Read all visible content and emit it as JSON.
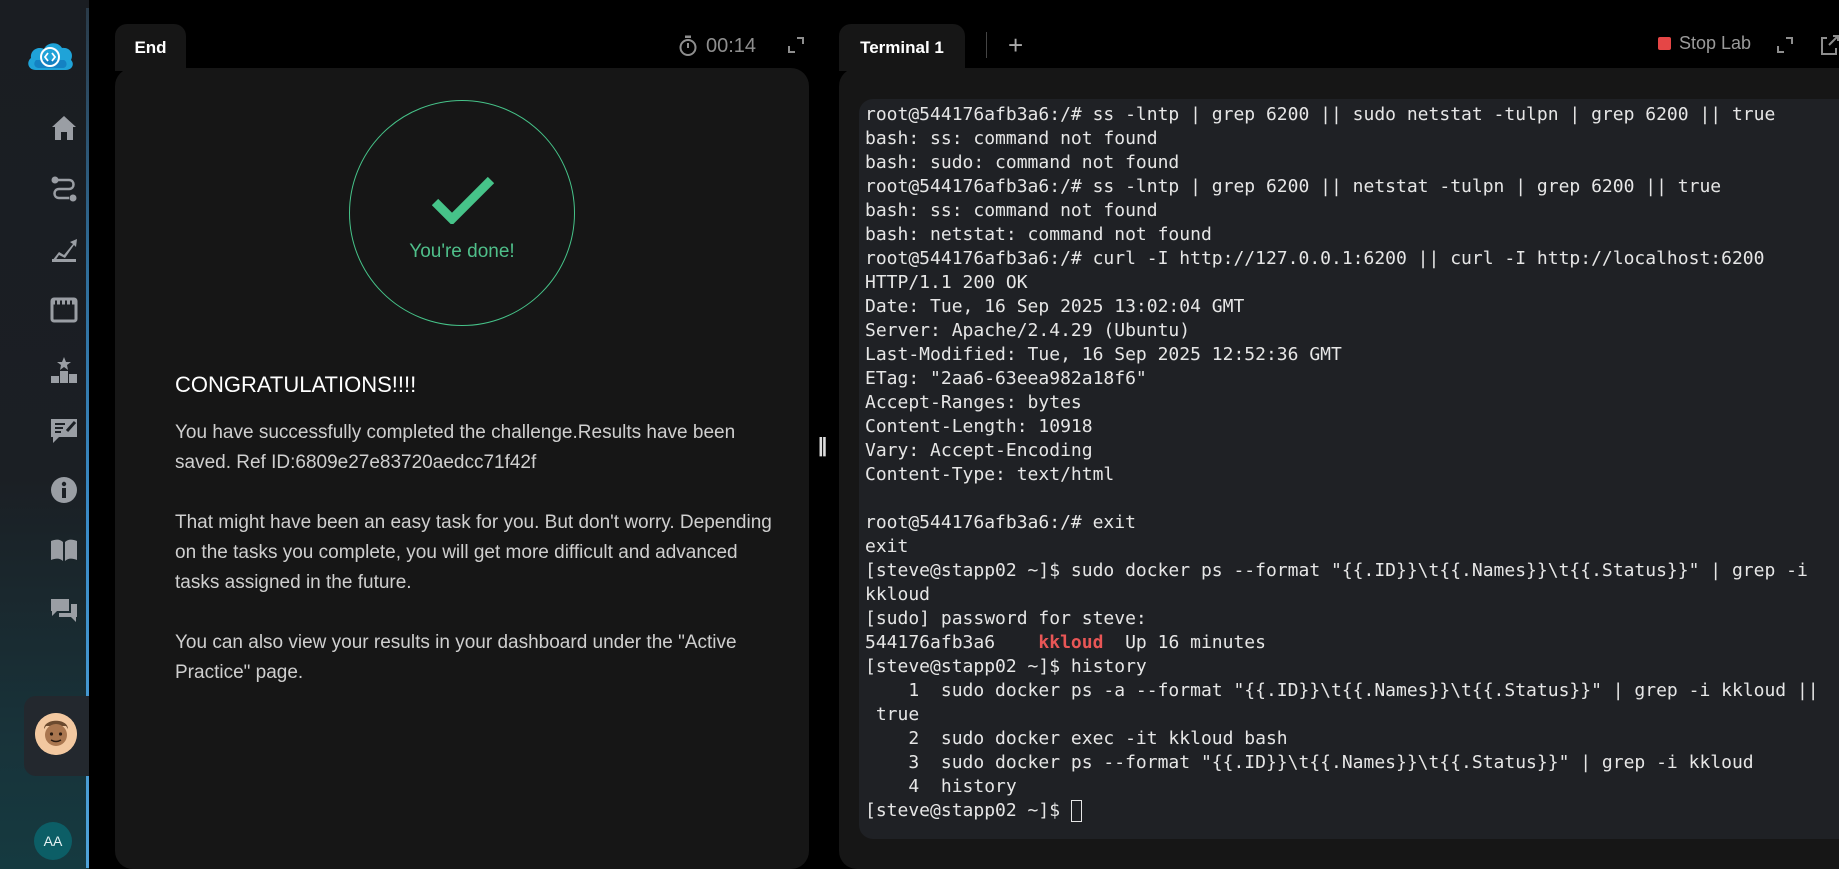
{
  "sidebar": {
    "nav_icons": [
      "home-icon",
      "route-icon",
      "progress-icon",
      "lab-icon",
      "leaderboard-icon",
      "review-icon",
      "info-icon",
      "book-icon",
      "chat-icon"
    ],
    "user_initials": "AA"
  },
  "left_panel": {
    "tab_label": "End",
    "timer": "00:14",
    "done_text": "You're done!",
    "heading": "CONGRATULATIONS!!!!",
    "paragraphs": [
      "You have successfully completed the challenge.Results have been saved. Ref ID:6809e27e83720aedcc71f42f",
      "That might have been an easy task for you. But don't worry. Depending on the tasks you complete, you will get more difficult and advanced tasks assigned in the future.",
      "You can also view your results in your dashboard under the \"Active Practice\" page."
    ]
  },
  "right_panel": {
    "tab_label": "Terminal 1",
    "add_tab": "+",
    "stop_label": "Stop Lab"
  },
  "terminal": {
    "lines": [
      "root@544176afb3a6:/# ss -lntp | grep 6200 || sudo netstat -tulpn | grep 6200 || true",
      "bash: ss: command not found",
      "bash: sudo: command not found",
      "root@544176afb3a6:/# ss -lntp | grep 6200 || netstat -tulpn | grep 6200 || true",
      "bash: ss: command not found",
      "bash: netstat: command not found",
      "root@544176afb3a6:/# curl -I http://127.0.0.1:6200 || curl -I http://localhost:6200",
      "HTTP/1.1 200 OK",
      "Date: Tue, 16 Sep 2025 13:02:04 GMT",
      "Server: Apache/2.4.29 (Ubuntu)",
      "Last-Modified: Tue, 16 Sep 2025 12:52:36 GMT",
      "ETag: \"2aa6-63eea982a18f6\"",
      "Accept-Ranges: bytes",
      "Content-Length: 10918",
      "Vary: Accept-Encoding",
      "Content-Type: text/html",
      "",
      "root@544176afb3a6:/# exit",
      "exit",
      "[steve@stapp02 ~]$ sudo docker ps --format \"{{.ID}}\\t{{.Names}}\\t{{.Status}}\" | grep -i",
      "kkloud",
      "[sudo] password for steve:"
    ],
    "container_row": {
      "id": "544176afb3a6    ",
      "name": "kkloud",
      "status": "  Up 16 minutes"
    },
    "lines_after": [
      "[steve@stapp02 ~]$ history",
      "    1  sudo docker ps -a --format \"{{.ID}}\\t{{.Names}}\\t{{.Status}}\" | grep -i kkloud ||",
      " true",
      "    2  sudo docker exec -it kkloud bash",
      "    3  sudo docker ps --format \"{{.ID}}\\t{{.Names}}\\t{{.Status}}\" | grep -i kkloud",
      "    4  history"
    ],
    "prompt": "[steve@stapp02 ~]$ "
  },
  "colors": {
    "success": "#46c389",
    "stop": "#e54646",
    "highlight": "#e85656"
  }
}
